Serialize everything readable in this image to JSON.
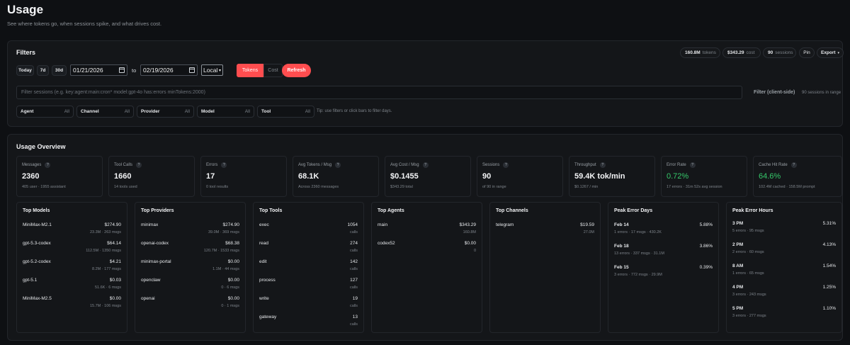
{
  "header": {
    "title": "Usage",
    "subtitle": "See where tokens go, when sessions spike, and what drives cost."
  },
  "filters": {
    "title": "Filters",
    "summary": {
      "tokens_value": "160.8M",
      "tokens_label": "tokens",
      "cost_value": "$343.29",
      "cost_label": "cost",
      "sessions_value": "90",
      "sessions_label": "sessions"
    },
    "pin_label": "Pin",
    "export_label": "Export",
    "presets": [
      "Today",
      "7d",
      "30d"
    ],
    "start_date": "01/21/2026",
    "to_label": "to",
    "end_date": "02/19/2026",
    "timezone": "Local",
    "mode_tokens": "Tokens",
    "mode_cost": "Cost",
    "refresh_label": "Refresh",
    "search_placeholder": "Filter sessions (e.g. key:agent:main:cron* model:gpt-4o has:errors minTokens:2000)",
    "client_side_label": "Filter (client-side)",
    "sessions_in_range": "90 sessions in range",
    "selects": [
      {
        "label": "Agent",
        "value": "All"
      },
      {
        "label": "Channel",
        "value": "All"
      },
      {
        "label": "Provider",
        "value": "All"
      },
      {
        "label": "Model",
        "value": "All"
      },
      {
        "label": "Tool",
        "value": "All"
      }
    ],
    "tip": "Tip: use filters or click bars to filter days."
  },
  "overview": {
    "title": "Usage Overview",
    "stats": [
      {
        "label": "Messages",
        "value": "2360",
        "sub": "405 user · 1955 assistant"
      },
      {
        "label": "Tool Calls",
        "value": "1660",
        "sub": "14 tools used"
      },
      {
        "label": "Errors",
        "value": "17",
        "sub": "0 tool results"
      },
      {
        "label": "Avg Tokens / Msg",
        "value": "68.1K",
        "sub": "Across 2360 messages"
      },
      {
        "label": "Avg Cost / Msg",
        "value": "$0.1455",
        "sub": "$343.29 total"
      },
      {
        "label": "Sessions",
        "value": "90",
        "sub": "of 90 in range"
      },
      {
        "label": "Throughput",
        "value": "59.4K tok/min",
        "sub": "$0.1267 / min"
      },
      {
        "label": "Error Rate",
        "value": "0.72%",
        "sub": "17 errors · 31m 52s avg session"
      },
      {
        "label": "Cache Hit Rate",
        "value": "64.6%",
        "sub": "102.4M cached · 158.5M prompt"
      }
    ],
    "cards": {
      "top_models": {
        "title": "Top Models",
        "rows": [
          {
            "name": "MiniMax-M2.1",
            "value": "$274.90",
            "detail": "23.3M · 263 msgs"
          },
          {
            "name": "gpt-5.3-codex",
            "value": "$64.14",
            "detail": "112.5M · 1350 msgs"
          },
          {
            "name": "gpt-5.2-codex",
            "value": "$4.21",
            "detail": "8.2M · 177 msgs"
          },
          {
            "name": "gpt-5.1",
            "value": "$0.03",
            "detail": "51.6K · 6 msgs"
          },
          {
            "name": "MiniMax-M2.5",
            "value": "$0.00",
            "detail": "15.7M · 106 msgs"
          }
        ]
      },
      "top_providers": {
        "title": "Top Providers",
        "rows": [
          {
            "name": "minimax",
            "value": "$274.90",
            "detail": "39.0M · 369 msgs"
          },
          {
            "name": "openai-codex",
            "value": "$68.38",
            "detail": "120.7M · 1533 msgs"
          },
          {
            "name": "minimax-portal",
            "value": "$0.00",
            "detail": "1.1M · 44 msgs"
          },
          {
            "name": "openclaw",
            "value": "$0.00",
            "detail": "0 · 6 msgs"
          },
          {
            "name": "openai",
            "value": "$0.00",
            "detail": "0 · 1 msgs"
          }
        ]
      },
      "top_tools": {
        "title": "Top Tools",
        "rows": [
          {
            "name": "exec",
            "value": "1054",
            "detail": "calls"
          },
          {
            "name": "read",
            "value": "274",
            "detail": "calls"
          },
          {
            "name": "edit",
            "value": "142",
            "detail": "calls"
          },
          {
            "name": "process",
            "value": "127",
            "detail": "calls"
          },
          {
            "name": "write",
            "value": "19",
            "detail": "calls"
          },
          {
            "name": "gateway",
            "value": "13",
            "detail": "calls"
          }
        ]
      },
      "top_agents": {
        "title": "Top Agents",
        "rows": [
          {
            "name": "main",
            "value": "$343.29",
            "detail": "160.8M"
          },
          {
            "name": "codex52",
            "value": "$0.00",
            "detail": "0"
          }
        ]
      },
      "top_channels": {
        "title": "Top Channels",
        "rows": [
          {
            "name": "telegram",
            "value": "$19.59",
            "detail": "27.0M"
          }
        ]
      },
      "peak_error_days": {
        "title": "Peak Error Days",
        "rows": [
          {
            "name": "Feb 14",
            "value": "5.88%",
            "detail": "1 errors · 17 msgs · 430.2K"
          },
          {
            "name": "Feb 18",
            "value": "3.86%",
            "detail": "13 errors · 337 msgs · 31.1M"
          },
          {
            "name": "Feb 15",
            "value": "0.39%",
            "detail": "3 errors · 772 msgs · 29.9M"
          }
        ]
      },
      "peak_error_hours": {
        "title": "Peak Error Hours",
        "rows": [
          {
            "name": "3 PM",
            "value": "5.31%",
            "detail": "5 errors · 95 msgs"
          },
          {
            "name": "2 PM",
            "value": "4.13%",
            "detail": "2 errors · 60 msgs"
          },
          {
            "name": "8 AM",
            "value": "1.54%",
            "detail": "1 errors · 65 msgs"
          },
          {
            "name": "4 PM",
            "value": "1.25%",
            "detail": "3 errors · 243 msgs"
          },
          {
            "name": "5 PM",
            "value": "1.10%",
            "detail": "3 errors · 277 msgs"
          }
        ]
      }
    }
  },
  "colors": {
    "accent": "#ff4d4f",
    "success": "#35c86a",
    "background": "#0e1013",
    "panel": "#141619"
  }
}
